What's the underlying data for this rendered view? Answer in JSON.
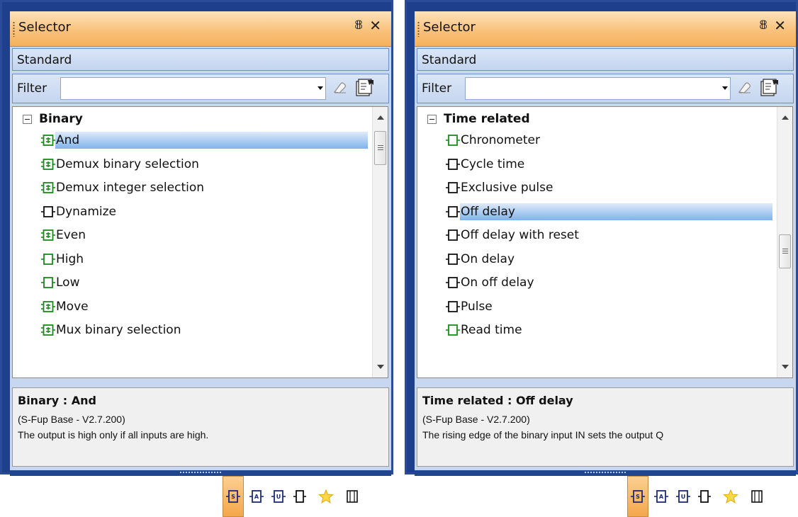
{
  "colors": {
    "green_icon": "#1a8a1a",
    "black_icon": "#111111",
    "title_orange": "#f9c27b",
    "frame_blue": "#1d3f8c",
    "selection_blue": "#7fb3ec"
  },
  "panels": [
    {
      "title": "Selector",
      "tab_label": "Standard",
      "filter_label": "Filter",
      "filter_value": "",
      "group_label": "Binary",
      "items": [
        {
          "label": "And",
          "icon": "multi-green-icon"
        },
        {
          "label": "Demux binary selection",
          "icon": "multi-green-icon"
        },
        {
          "label": "Demux integer selection",
          "icon": "multi-green-icon"
        },
        {
          "label": "Dynamize",
          "icon": "fb-black-icon"
        },
        {
          "label": "Even",
          "icon": "multi-green-icon"
        },
        {
          "label": "High",
          "icon": "fb-green-icon"
        },
        {
          "label": "Low",
          "icon": "fb-green-icon"
        },
        {
          "label": "Move",
          "icon": "multi-green-icon"
        },
        {
          "label": "Mux binary selection",
          "icon": "multi-green-icon"
        }
      ],
      "selected_index": 0,
      "desc_title": "Binary : And",
      "desc_version": "(S-Fup Base - V2.7.200)",
      "desc_text": "The output is high only if all inputs are high."
    },
    {
      "title": "Selector",
      "tab_label": "Standard",
      "filter_label": "Filter",
      "filter_value": "",
      "group_label": "Time related",
      "items": [
        {
          "label": "Chronometer",
          "icon": "fb-green-icon"
        },
        {
          "label": "Cycle time",
          "icon": "fb-black-icon"
        },
        {
          "label": "Exclusive pulse",
          "icon": "fb-black-icon"
        },
        {
          "label": "Off delay",
          "icon": "fb-black-icon"
        },
        {
          "label": "Off delay with reset",
          "icon": "fb-black-icon"
        },
        {
          "label": "On delay",
          "icon": "fb-black-icon"
        },
        {
          "label": "On off delay",
          "icon": "fb-black-icon"
        },
        {
          "label": "Pulse",
          "icon": "fb-black-icon"
        },
        {
          "label": "Read time",
          "icon": "fb-green-icon"
        }
      ],
      "selected_index": 3,
      "desc_title": "Time related : Off delay",
      "desc_version": "(S-Fup Base - V2.7.200)",
      "desc_text": "The rising edge of the binary input IN sets the output Q"
    }
  ],
  "toolbar_icons": [
    "standard-library-icon",
    "advanced-library-icon",
    "user-library-icon",
    "function-block-icon",
    "favorites-star-icon",
    "panel-view-icon"
  ]
}
